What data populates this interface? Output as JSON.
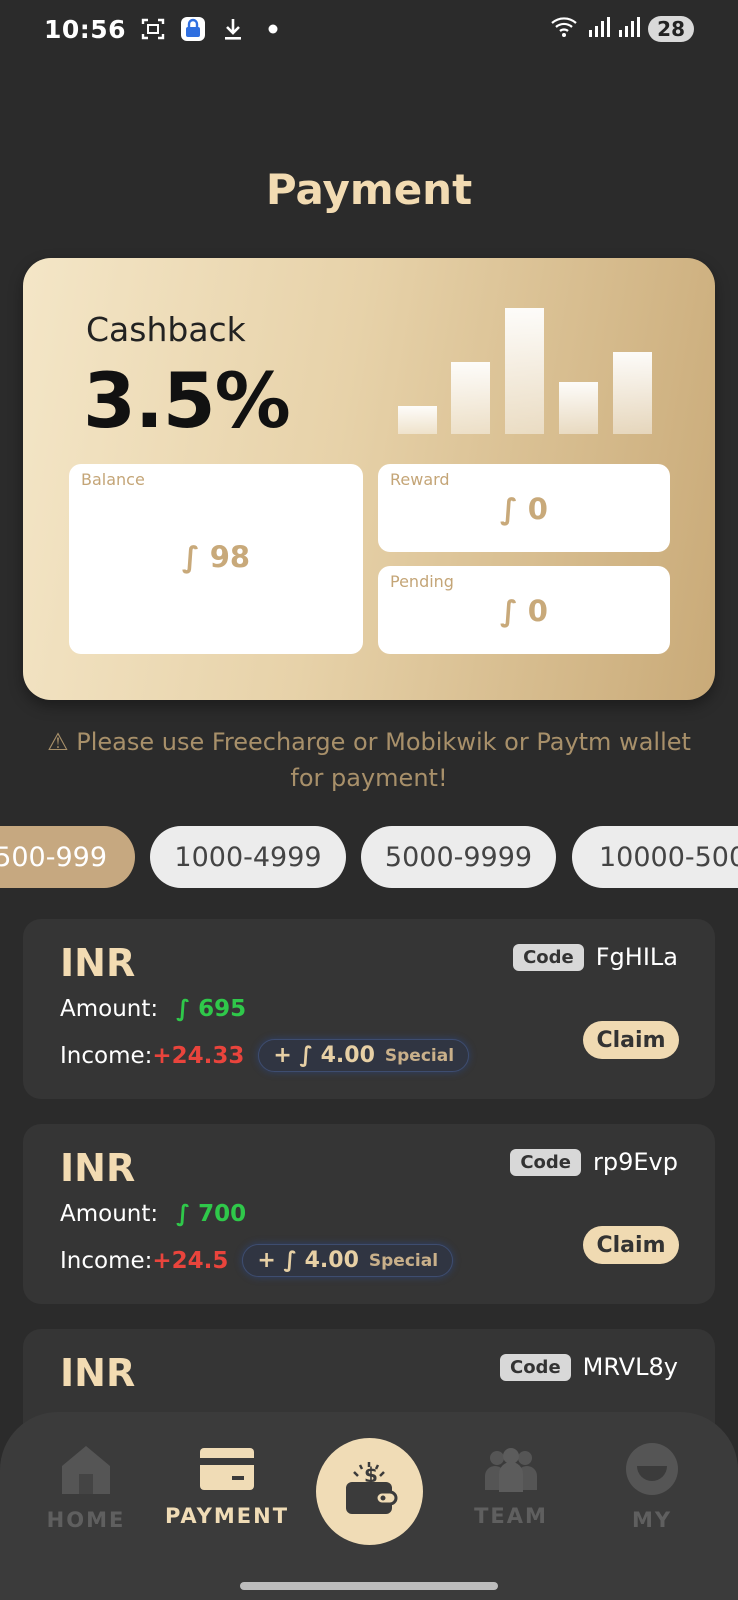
{
  "status_bar": {
    "time": "10:56",
    "battery": "28",
    "left_icons": [
      "screenshot-icon",
      "vpn-lock-icon",
      "download-icon",
      "dot-icon"
    ],
    "right_icons": [
      "wifi-icon",
      "signal-icon",
      "signal-icon"
    ]
  },
  "header": {
    "title": "Payment"
  },
  "card": {
    "cashback_label": "Cashback",
    "cashback_value": "3.5%",
    "balance": {
      "label": "Balance",
      "value": "∫ 98"
    },
    "reward": {
      "label": "Reward",
      "value": "∫ 0"
    },
    "pending": {
      "label": "Pending",
      "value": "∫ 0"
    }
  },
  "notice": "⚠ Please use Freecharge or Mobikwik or Paytm wallet for payment!",
  "chips": [
    {
      "label": "500-999",
      "active": true
    },
    {
      "label": "1000-4999",
      "active": false
    },
    {
      "label": "5000-9999",
      "active": false
    },
    {
      "label": "10000-500",
      "active": false
    }
  ],
  "items": [
    {
      "currency": "INR",
      "code_label": "Code",
      "code": "FgHILa",
      "amount_label": "Amount:",
      "amount": "∫ 695",
      "income_label": "Income:",
      "income": "+24.33",
      "bonus": "+ ∫ 4.00",
      "bonus_tag": "Special",
      "action": "Claim"
    },
    {
      "currency": "INR",
      "code_label": "Code",
      "code": "rp9Evp",
      "amount_label": "Amount:",
      "amount": "∫ 700",
      "income_label": "Income:",
      "income": "+24.5",
      "bonus": "+ ∫ 4.00",
      "bonus_tag": "Special",
      "action": "Claim"
    },
    {
      "currency": "INR",
      "code_label": "Code",
      "code": "MRVL8y"
    }
  ],
  "nav": {
    "home": "HOME",
    "payment": "PAYMENT",
    "team": "TEAM",
    "my": "MY",
    "active": "payment"
  },
  "colors": {
    "background": "#2b2b2b",
    "accent_gold": "#f2dbb2",
    "amount_green": "#2fc84a",
    "income_red": "#e9443c"
  }
}
